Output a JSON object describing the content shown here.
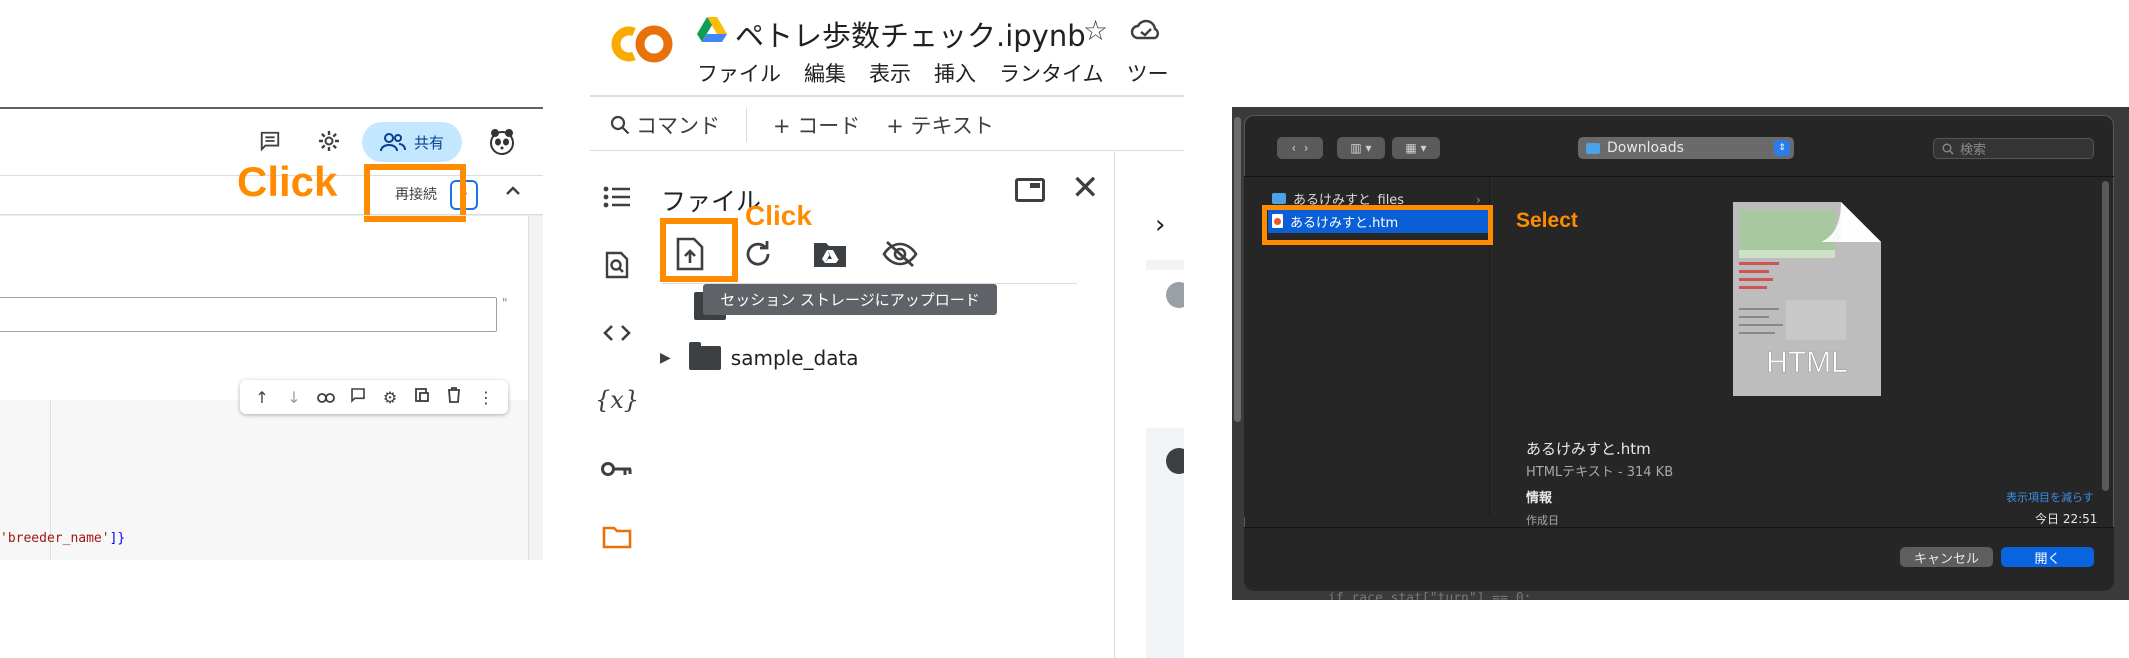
{
  "panel1": {
    "share_label": "共有",
    "click_label": "Click",
    "reconnect_label": "再接続",
    "code_prefix": "'breeder_name'",
    "code_suffix": "]}",
    "icons": [
      "comment-icon",
      "gear-icon",
      "people-icon",
      "avatar-icon",
      "chevron-up-icon"
    ],
    "cell_toolbar_icons": [
      "arrow-up-icon",
      "arrow-down-icon",
      "link-icon",
      "comment-icon",
      "gear-icon",
      "mirror-icon",
      "delete-icon",
      "more-icon"
    ]
  },
  "panel2": {
    "title": "ペトレ歩数チェック.ipynb",
    "menu": [
      "ファイル",
      "編集",
      "表示",
      "挿入",
      "ランタイム",
      "ツー"
    ],
    "toolbar": {
      "command": "コマンド",
      "add_code": "+ コード",
      "add_text": "+ テキスト"
    },
    "files_title": "ファイル",
    "click_label": "Click",
    "tooltip": "セッション ストレージにアップロード",
    "tree": [
      {
        "name": ".."
      },
      {
        "name": "sample_data"
      }
    ]
  },
  "panel3": {
    "location": "Downloads",
    "search_placeholder": "検索",
    "files": [
      {
        "name": "あるけみすと_files"
      },
      {
        "name": "あるけみすと.htm"
      }
    ],
    "select_label": "Select",
    "thumb_label": "HTML",
    "preview": {
      "name": "あるけみすと.htm",
      "type": "HTMLテキスト - 314 KB",
      "info": "情報",
      "show_less": "表示項目を減らす",
      "created_label": "作成日",
      "created_value": "今日 22:51"
    },
    "cancel_label": "キャンセル",
    "open_label": "開く",
    "bg_code": "if race_stat[\"turn\"] == 0:"
  },
  "colors": {
    "annotation": "#ff8c00",
    "share_bg": "#c2e7ff",
    "selection": "#0a5fd6",
    "open_button": "#0a64e0",
    "colab_orange": "#f9ab00"
  }
}
